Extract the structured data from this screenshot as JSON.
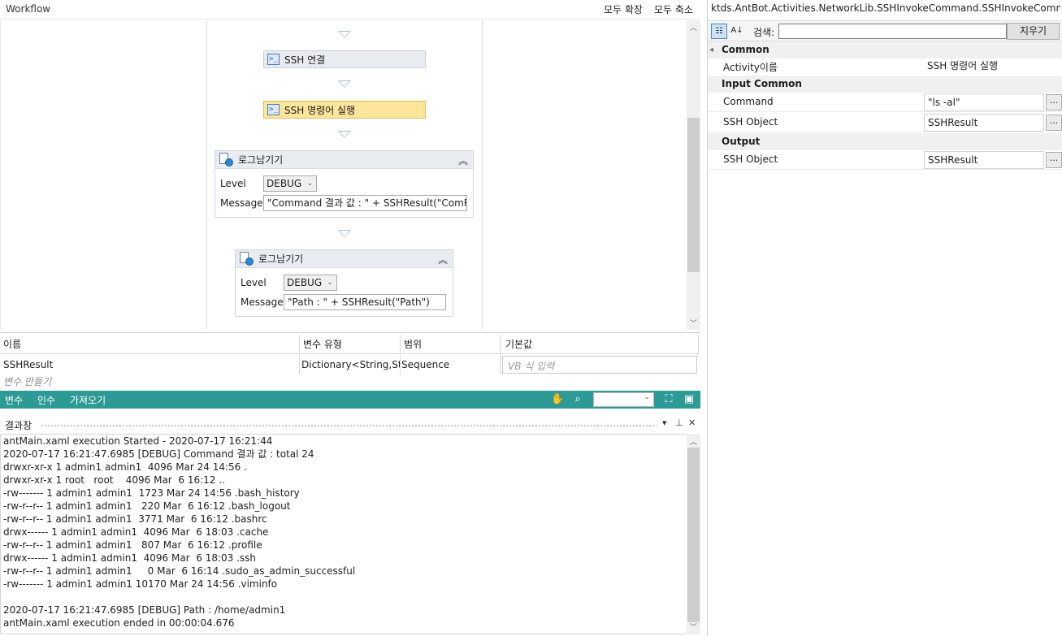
{
  "workflow": {
    "title": "Workflow",
    "expand_all": "모두 확장",
    "collapse_all": "모두 축소",
    "activities": [
      {
        "label": "SSH 연결",
        "icon": "terminal-icon"
      },
      {
        "label": "SSH 명령어 실행",
        "icon": "terminal-icon"
      }
    ],
    "log1": {
      "title": "로그남기기",
      "level_label": "Level",
      "level_value": "DEBUG",
      "message_label": "Message",
      "message_value": "\"Command 결과 값 : \" + SSHResult(\"ComRe"
    },
    "log2": {
      "title": "로그남기기",
      "level_label": "Level",
      "level_value": "DEBUG",
      "message_label": "Message",
      "message_value": "\"Path : \" + SSHResult(\"Path\")"
    }
  },
  "variables": {
    "headers": [
      "이름",
      "변수 유형",
      "범위",
      "기본값"
    ],
    "rows": [
      {
        "name": "SSHResult",
        "type": "Dictionary<String,Strin",
        "scope": "Sequence",
        "default_placeholder": "VB 식 입력"
      }
    ],
    "create_label": "변수 만들기",
    "tabs": [
      "변수",
      "인수",
      "가져오기"
    ]
  },
  "output": {
    "title": "결과창",
    "lines": [
      "antMain.xaml execution Started - 2020-07-17 16:21:44",
      "2020-07-17 16:21:47.6985 [DEBUG] Command 결과 값 : total 24",
      "drwxr-xr-x 1 admin1 admin1  4096 Mar 24 14:56 .",
      "drwxr-xr-x 1 root   root    4096 Mar  6 16:12 ..",
      "-rw------- 1 admin1 admin1  1723 Mar 24 14:56 .bash_history",
      "-rw-r--r-- 1 admin1 admin1   220 Mar  6 16:12 .bash_logout",
      "-rw-r--r-- 1 admin1 admin1  3771 Mar  6 16:12 .bashrc",
      "drwx------ 1 admin1 admin1  4096 Mar  6 18:03 .cache",
      "-rw-r--r-- 1 admin1 admin1   807 Mar  6 16:12 .profile",
      "drwx------ 1 admin1 admin1  4096 Mar  6 18:03 .ssh",
      "-rw-r--r-- 1 admin1 admin1     0 Mar  6 16:14 .sudo_as_admin_successful",
      "-rw------- 1 admin1 admin1 10170 Mar 24 14:56 .viminfo",
      "",
      "2020-07-17 16:21:47.6985 [DEBUG] Path : /home/admin1",
      "antMain.xaml execution ended in 00:00:04.676"
    ]
  },
  "properties": {
    "title": "ktds.AntBot.Activities.NetworkLib.SSHInvokeCommand.SSHInvokeCommandA...",
    "search_label": "검색:",
    "clear_label": "지우기",
    "categories": {
      "common": "Common",
      "input_common": "Input Common",
      "output": "Output"
    },
    "rows": {
      "activity_name": {
        "name": "Activity이름",
        "value": "SSH 명령어 실행"
      },
      "command": {
        "name": "Command",
        "value": "\"ls -al\""
      },
      "ssh_object_in": {
        "name": "SSH Object",
        "value": "SSHResult"
      },
      "ssh_object_out": {
        "name": "SSH Object",
        "value": "SSHResult"
      }
    },
    "ellipsis": "..."
  },
  "colors": {
    "accent_teal": "#2e9a96",
    "selected_activity": "#fde59c"
  }
}
